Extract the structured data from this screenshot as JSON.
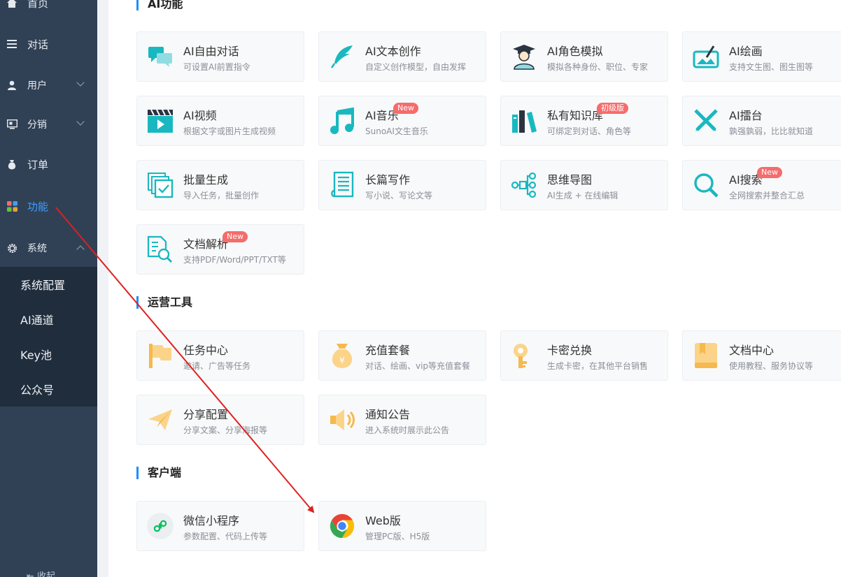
{
  "sidebar": {
    "items": [
      {
        "label": "首页",
        "icon": "home-icon"
      },
      {
        "label": "对话",
        "icon": "menu-lines-icon"
      },
      {
        "label": "用户",
        "icon": "user-icon"
      },
      {
        "label": "分销",
        "icon": "distribution-icon"
      },
      {
        "label": "订单",
        "icon": "money-bag-icon"
      },
      {
        "label": "功能",
        "icon": "grid-apps-icon"
      },
      {
        "label": "系统",
        "icon": "gear-icon"
      }
    ],
    "submenu": [
      "系统配置",
      "AI通道",
      "Key池",
      "公众号"
    ],
    "collapse_label": "收起",
    "active_color": "#409eff"
  },
  "sections": {
    "ai": {
      "title": "AI功能",
      "cards": [
        {
          "title": "AI自由对话",
          "desc": "可设置AI前置指令",
          "icon": "chat-bubbles-icon"
        },
        {
          "title": "AI文本创作",
          "desc": "自定义创作模型，自由发挥",
          "icon": "feather-icon"
        },
        {
          "title": "AI角色模拟",
          "desc": "模拟各种身份、职位、专家",
          "icon": "graduate-icon"
        },
        {
          "title": "AI绘画",
          "desc": "支持文生图、图生图等",
          "icon": "painting-icon"
        },
        {
          "title": "AI视频",
          "desc": "根据文字或图片生成视频",
          "icon": "video-clapper-icon"
        },
        {
          "title": "AI音乐",
          "desc": "SunoAI文生音乐",
          "icon": "music-note-icon",
          "badge": "New"
        },
        {
          "title": "私有知识库",
          "desc": "可绑定到对话、角色等",
          "icon": "books-icon",
          "badge": "初级版"
        },
        {
          "title": "AI擂台",
          "desc": "孰强孰弱，比比就知道",
          "icon": "crossed-swords-icon"
        },
        {
          "title": "批量生成",
          "desc": "导入任务，批量创作",
          "icon": "batch-check-icon"
        },
        {
          "title": "长篇写作",
          "desc": "写小说、写论文等",
          "icon": "document-scroll-icon"
        },
        {
          "title": "思维导图",
          "desc": "AI生成 + 在线编辑",
          "icon": "mind-map-icon"
        },
        {
          "title": "AI搜索",
          "desc": "全网搜索并整合汇总",
          "icon": "search-icon",
          "badge": "New"
        },
        {
          "title": "文档解析",
          "desc": "支持PDF/Word/PPT/TXT等",
          "icon": "document-search-icon",
          "badge": "New"
        }
      ]
    },
    "ops": {
      "title": "运营工具",
      "cards": [
        {
          "title": "任务中心",
          "desc": "邀请、广告等任务",
          "icon": "flag-icon"
        },
        {
          "title": "充值套餐",
          "desc": "对话、绘画、vip等充值套餐",
          "icon": "money-bag-icon"
        },
        {
          "title": "卡密兑换",
          "desc": "生成卡密，在其他平台销售",
          "icon": "key-icon"
        },
        {
          "title": "文档中心",
          "desc": "使用教程、服务协议等",
          "icon": "book-icon"
        },
        {
          "title": "分享配置",
          "desc": "分享文案、分享海报等",
          "icon": "paper-plane-icon"
        },
        {
          "title": "通知公告",
          "desc": "进入系统时展示此公告",
          "icon": "speaker-icon"
        }
      ]
    },
    "client": {
      "title": "客户端",
      "cards": [
        {
          "title": "微信小程序",
          "desc": "参数配置、代码上传等",
          "icon": "mini-program-icon"
        },
        {
          "title": "Web版",
          "desc": "管理PC版、H5版",
          "icon": "chrome-icon"
        }
      ]
    }
  },
  "colors": {
    "sidebar_bg": "#304156",
    "submenu_bg": "#1f2d3d",
    "ai_icon": "#19b8c0",
    "ops_icon": "#f5b94d",
    "badge": "#f56c6c",
    "arrow": "#e02020"
  }
}
